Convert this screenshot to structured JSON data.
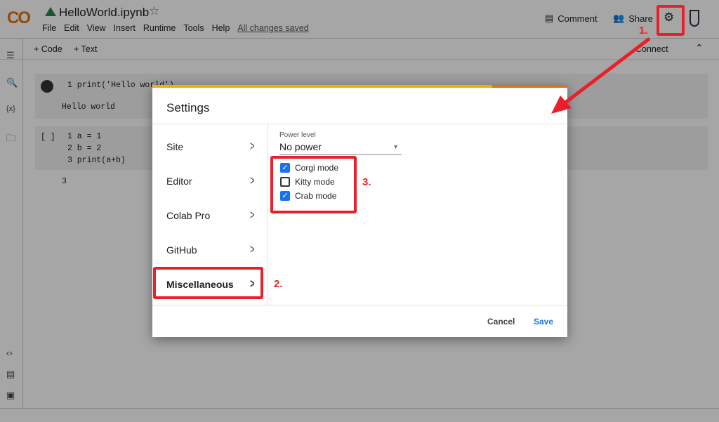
{
  "app": {
    "logo": "CO",
    "title": "HelloWorld.ipynb",
    "menu": [
      "File",
      "Edit",
      "View",
      "Insert",
      "Runtime",
      "Tools",
      "Help"
    ],
    "saved": "All changes saved",
    "comment": "Comment",
    "share": "Share"
  },
  "toolbar": {
    "code": "+ Code",
    "text": "+ Text",
    "connect": "Connect"
  },
  "cells": [
    {
      "gutter": "",
      "lines": [
        "1 print('Hello world')"
      ],
      "output": "Hello world"
    },
    {
      "gutter": "[ ]",
      "lines": [
        "1 a = 1",
        "2 b = 2",
        "3 print(a+b)"
      ],
      "output": "3"
    }
  ],
  "dialog": {
    "title": "Settings",
    "nav": [
      "Site",
      "Editor",
      "Colab Pro",
      "GitHub",
      "Miscellaneous"
    ],
    "selected": "Miscellaneous",
    "power_label": "Power level",
    "power_value": "No power",
    "checkboxes": [
      {
        "label": "Corgi mode",
        "checked": true
      },
      {
        "label": "Kitty mode",
        "checked": false
      },
      {
        "label": "Crab mode",
        "checked": true
      }
    ],
    "cancel": "Cancel",
    "save": "Save"
  },
  "annotations": [
    "1.",
    "2.",
    "3."
  ],
  "colors": {
    "accent": "#1a73e8",
    "annotation": "#e8202a",
    "brand": "#f9ab00"
  }
}
